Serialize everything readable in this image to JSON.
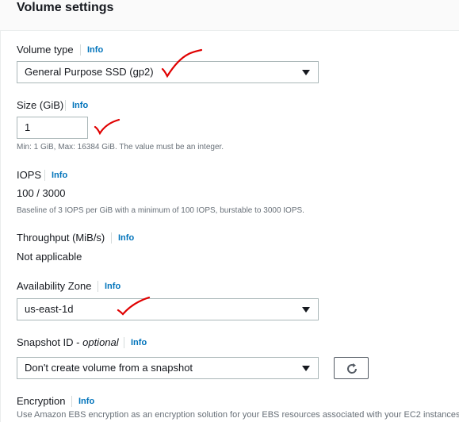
{
  "panel": {
    "title": "Volume settings"
  },
  "info_label": "Info",
  "volume_type": {
    "label": "Volume type",
    "selected": "General Purpose SSD (gp2)"
  },
  "size": {
    "label": "Size (GiB)",
    "value": "1",
    "hint": "Min: 1 GiB, Max: 16384 GiB. The value must be an integer."
  },
  "iops": {
    "label": "IOPS",
    "value": "100 / 3000",
    "hint": "Baseline of 3 IOPS per GiB with a minimum of 100 IOPS, burstable to 3000 IOPS."
  },
  "throughput": {
    "label": "Throughput (MiB/s)",
    "value": "Not applicable"
  },
  "availability_zone": {
    "label": "Availability Zone",
    "selected": "us-east-1d"
  },
  "snapshot": {
    "label": "Snapshot ID - ",
    "label_optional": "optional",
    "selected": "Don't create volume from a snapshot"
  },
  "encryption": {
    "label": "Encryption",
    "hint": "Use Amazon EBS encryption as an encryption solution for your EBS resources associated with your EC2 instances."
  },
  "colors": {
    "link": "#0073bb",
    "annotation": "#e00000",
    "border": "#aab7b8"
  },
  "icons": {
    "dropdown": "caret-down-icon",
    "refresh": "refresh-icon"
  }
}
